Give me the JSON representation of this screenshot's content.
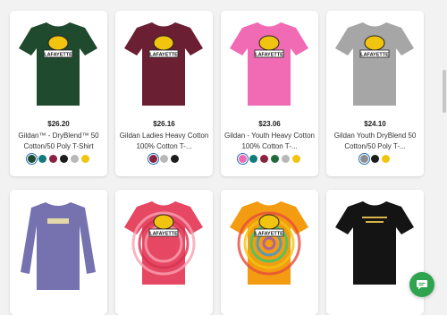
{
  "products": [
    {
      "price": "$26.20",
      "name": "Gildan™ - DryBlend™ 50 Cotton/50 Poly T-Shirt",
      "shirt_color": "#1f4a2e",
      "sleeve": "short",
      "print": "logo",
      "swatches": [
        "#1f4a2e",
        "#127a7a",
        "#8a2240",
        "#1c1c1c",
        "#b8b8b8",
        "#f1c40f"
      ],
      "selected_swatch": 0
    },
    {
      "price": "$26.16",
      "name": "Gildan Ladies Heavy Cotton 100% Cotton T-...",
      "shirt_color": "#6b1f33",
      "sleeve": "short",
      "print": "logo",
      "swatches": [
        "#8a2240",
        "#b8b8b8",
        "#1c1c1c"
      ],
      "selected_swatch": 0
    },
    {
      "price": "$23.06",
      "name": "Gildan - Youth Heavy Cotton 100% Cotton T-...",
      "shirt_color": "#f06bb3",
      "sleeve": "short",
      "print": "logo",
      "swatches": [
        "#f06bb3",
        "#127a7a",
        "#8a2240",
        "#1f6b3a",
        "#b8b8b8",
        "#f1c40f"
      ],
      "selected_swatch": 0
    },
    {
      "price": "$24.10",
      "name": "Gildan Youth DryBlend 50 Cotton/50 Poly T-...",
      "shirt_color": "#a6a6a6",
      "sleeve": "short",
      "print": "logo",
      "swatches": [
        "#8e8e8e",
        "#1c1c1c",
        "#f1c40f"
      ],
      "selected_swatch": 0
    },
    {
      "price": "",
      "name": "",
      "shirt_color": "#7672b0",
      "sleeve": "long",
      "print": "small",
      "swatches": [],
      "selected_swatch": -1
    },
    {
      "price": "",
      "name": "",
      "shirt_color": "#e64863",
      "sleeve": "short",
      "print": "logo",
      "swatches": [],
      "selected_swatch": -1
    },
    {
      "price": "",
      "name": "",
      "shirt_color": "#f39c12",
      "sleeve": "short",
      "print": "logo",
      "swatches": [],
      "selected_swatch": -1
    },
    {
      "price": "",
      "name": "",
      "shirt_color": "#141414",
      "sleeve": "short",
      "print": "text",
      "swatches": [],
      "selected_swatch": -1
    }
  ],
  "logo_text": "LAFAYETTE",
  "chat_icon": "chat-bubble-icon",
  "colors": {
    "accent": "#2ea44f",
    "selected_outline": "#1d6fb8"
  }
}
